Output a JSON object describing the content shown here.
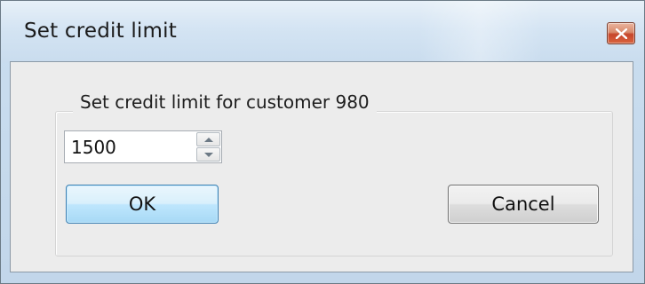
{
  "window": {
    "title": "Set credit limit",
    "close_icon": "close-icon"
  },
  "group": {
    "label": "Set credit limit for customer 980"
  },
  "credit_limit": {
    "value": "1500",
    "up_icon": "chevron-up-icon",
    "down_icon": "chevron-down-icon"
  },
  "buttons": {
    "ok_label": "OK",
    "cancel_label": "Cancel"
  },
  "colors": {
    "close_button": "#c7462a",
    "ok_border": "#3c7fb1",
    "client_bg": "#ececec"
  }
}
